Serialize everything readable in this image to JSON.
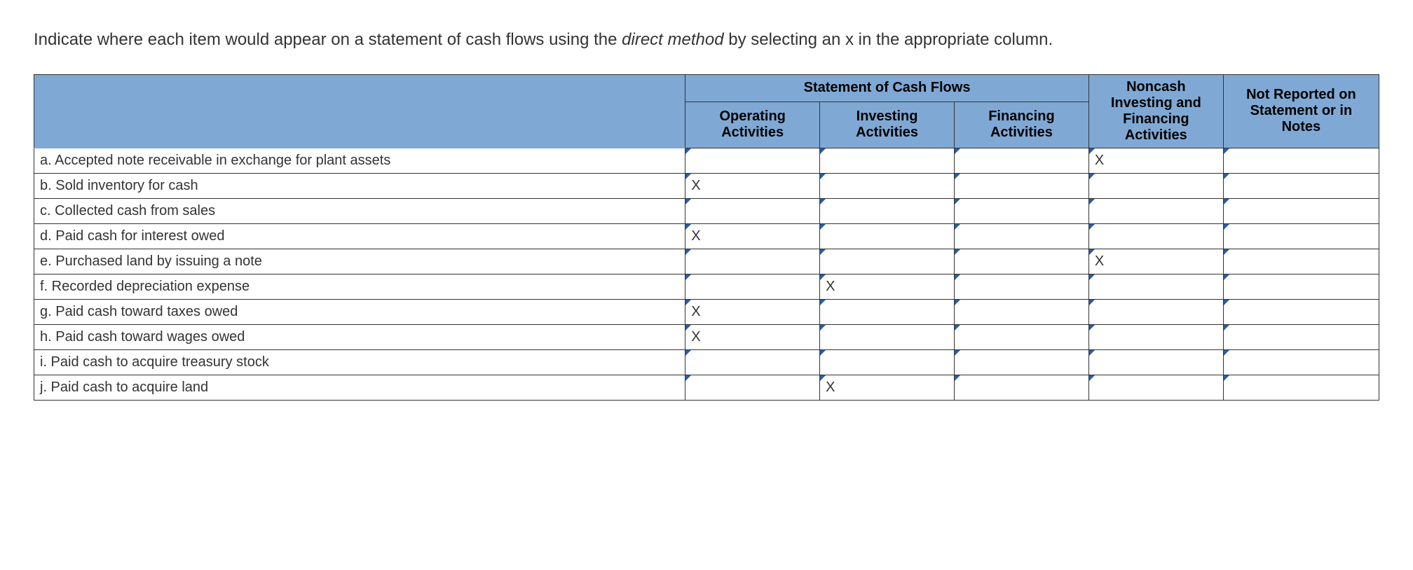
{
  "instructions_pre": "Indicate where each item would appear on a statement of cash flows using the ",
  "instructions_em": "direct method",
  "instructions_post": " by selecting an x in the appropriate column.",
  "headers": {
    "group": "Statement of Cash Flows",
    "operating": "Operating Activities",
    "investing": "Investing Activities",
    "financing": "Financing Activities",
    "noncash": "Noncash Investing and Financing Activities",
    "notreported": "Not Reported on Statement or in Notes"
  },
  "rows": [
    {
      "label": "a. Accepted note receivable in exchange for plant assets",
      "operating": "",
      "investing": "",
      "financing": "",
      "noncash": "X",
      "notreported": ""
    },
    {
      "label": "b. Sold inventory for cash",
      "operating": "X",
      "investing": "",
      "financing": "",
      "noncash": "",
      "notreported": ""
    },
    {
      "label": "c. Collected cash from sales",
      "operating": "",
      "investing": "",
      "financing": "",
      "noncash": "",
      "notreported": ""
    },
    {
      "label": "d. Paid cash for interest owed",
      "operating": "X",
      "investing": "",
      "financing": "",
      "noncash": "",
      "notreported": ""
    },
    {
      "label": "e. Purchased land by issuing a note",
      "operating": "",
      "investing": "",
      "financing": "",
      "noncash": "X",
      "notreported": ""
    },
    {
      "label": "f. Recorded depreciation expense",
      "operating": "",
      "investing": "X",
      "financing": "",
      "noncash": "",
      "notreported": ""
    },
    {
      "label": "g. Paid cash toward taxes owed",
      "operating": "X",
      "investing": "",
      "financing": "",
      "noncash": "",
      "notreported": ""
    },
    {
      "label": "h. Paid cash toward wages owed",
      "operating": "X",
      "investing": "",
      "financing": "",
      "noncash": "",
      "notreported": ""
    },
    {
      "label": "i. Paid cash to acquire treasury stock",
      "operating": "",
      "investing": "",
      "financing": "",
      "noncash": "",
      "notreported": ""
    },
    {
      "label": "j. Paid cash to acquire land",
      "operating": "",
      "investing": "X",
      "financing": "",
      "noncash": "",
      "notreported": ""
    }
  ]
}
